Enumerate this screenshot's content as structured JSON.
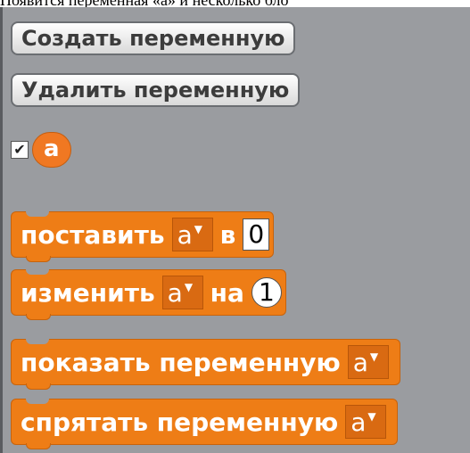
{
  "intro_text": "Появится переменная «а» и несколько бло",
  "buttons": {
    "create_variable": "Создать переменную",
    "delete_variable": "Удалить переменную"
  },
  "variable": {
    "checkbox_mark": "✔",
    "checked": true,
    "name": "a"
  },
  "blocks": {
    "set": {
      "label": "поставить",
      "var": "a",
      "prep": "в",
      "value": "0"
    },
    "change": {
      "label": "изменить",
      "var": "a",
      "prep": "на",
      "value": "1"
    },
    "show": {
      "label": "показать переменную",
      "var": "a"
    },
    "hide": {
      "label": "спрятать переменную",
      "var": "a"
    }
  },
  "dropdown_arrow": "▼",
  "colors": {
    "panel": "#9a9ca0",
    "block": "#ee7d16",
    "reporter": "#f07822"
  }
}
